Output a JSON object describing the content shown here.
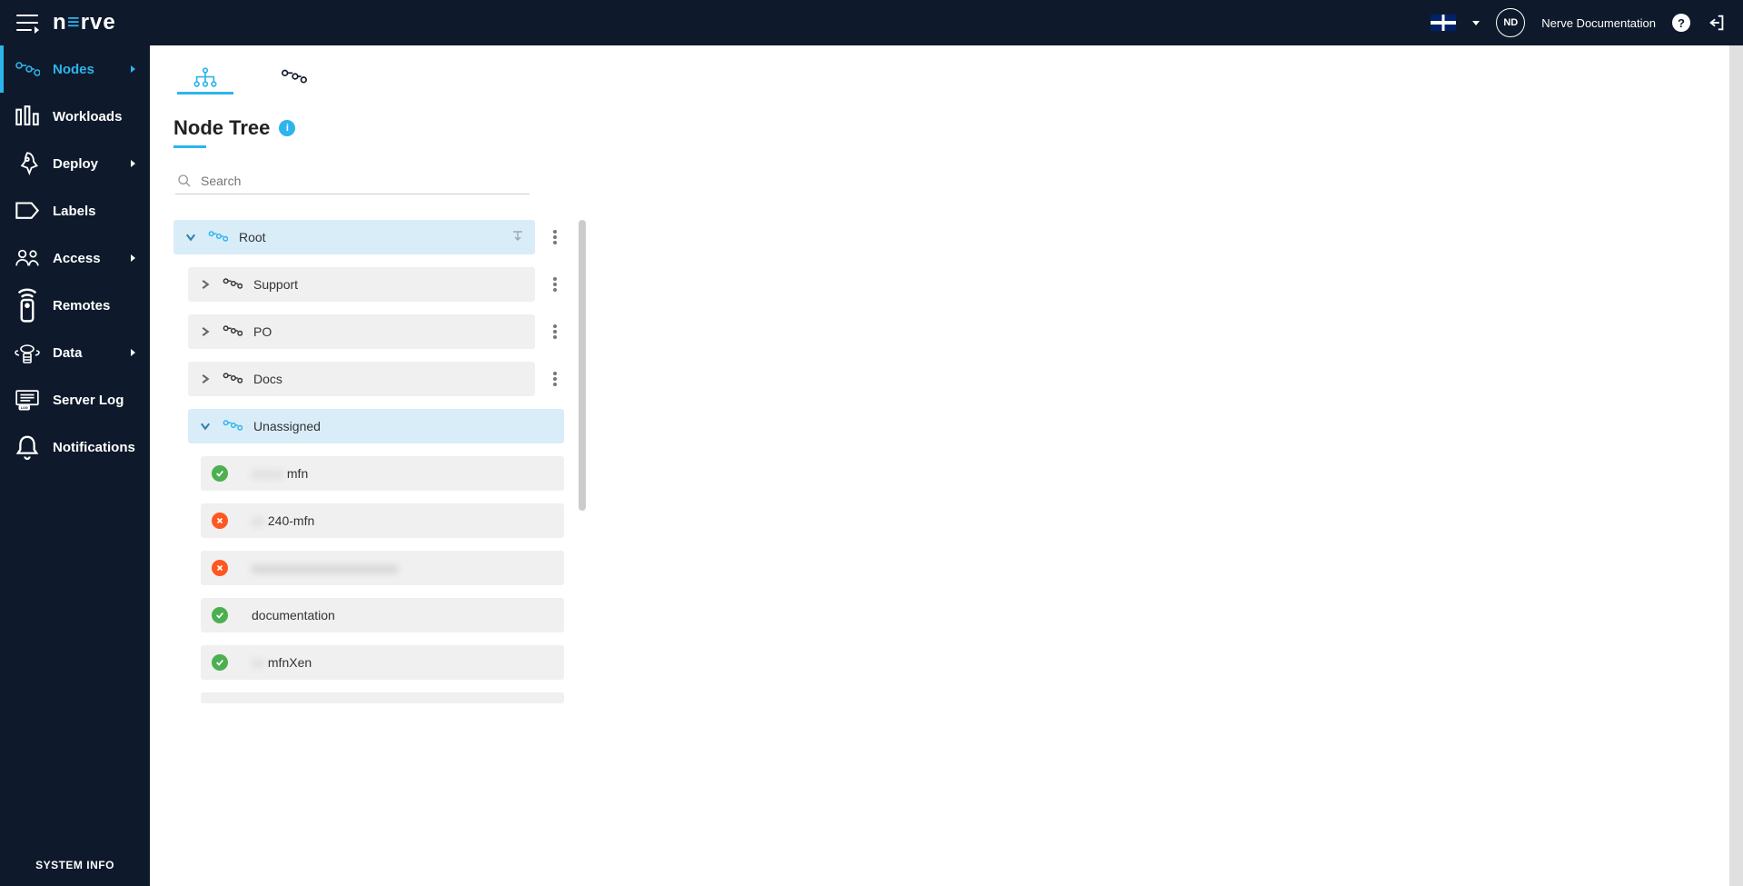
{
  "header": {
    "logo_left": "n",
    "logo_accent": "≡",
    "logo_right": "rve",
    "avatar_initials": "ND",
    "user_name": "Nerve Documentation"
  },
  "sidebar": {
    "items": [
      {
        "label": "Nodes",
        "icon": "nodes",
        "active": true,
        "expandable": true
      },
      {
        "label": "Workloads",
        "icon": "workloads",
        "active": false,
        "expandable": false
      },
      {
        "label": "Deploy",
        "icon": "deploy",
        "active": false,
        "expandable": true
      },
      {
        "label": "Labels",
        "icon": "labels",
        "active": false,
        "expandable": false
      },
      {
        "label": "Access",
        "icon": "access",
        "active": false,
        "expandable": true
      },
      {
        "label": "Remotes",
        "icon": "remotes",
        "active": false,
        "expandable": false
      },
      {
        "label": "Data",
        "icon": "data",
        "active": false,
        "expandable": true
      },
      {
        "label": "Server Log",
        "icon": "serverlog",
        "active": false,
        "expandable": false
      },
      {
        "label": "Notifications",
        "icon": "notifications",
        "active": false,
        "expandable": false
      }
    ],
    "system_info": "SYSTEM INFO"
  },
  "main": {
    "page_title": "Node Tree",
    "search_placeholder": "Search",
    "tree": {
      "root": {
        "label": "Root"
      },
      "children": [
        {
          "label": "Support",
          "type": "folder"
        },
        {
          "label": "PO",
          "type": "folder"
        },
        {
          "label": "Docs",
          "type": "folder"
        }
      ],
      "unassigned": {
        "label": "Unassigned",
        "nodes": [
          {
            "label_blur": "xxxxx",
            "label": "mfn",
            "status": "ok"
          },
          {
            "label_blur": "xx",
            "label": "240-mfn",
            "status": "err"
          },
          {
            "label_blur": "xxxxxxxxxxxxxxxxxxxxxxx",
            "label": "",
            "status": "err"
          },
          {
            "label_blur": "",
            "label": "documentation",
            "status": "ok"
          },
          {
            "label_blur": "xx",
            "label": "mfnXen",
            "status": "ok"
          }
        ]
      }
    }
  }
}
